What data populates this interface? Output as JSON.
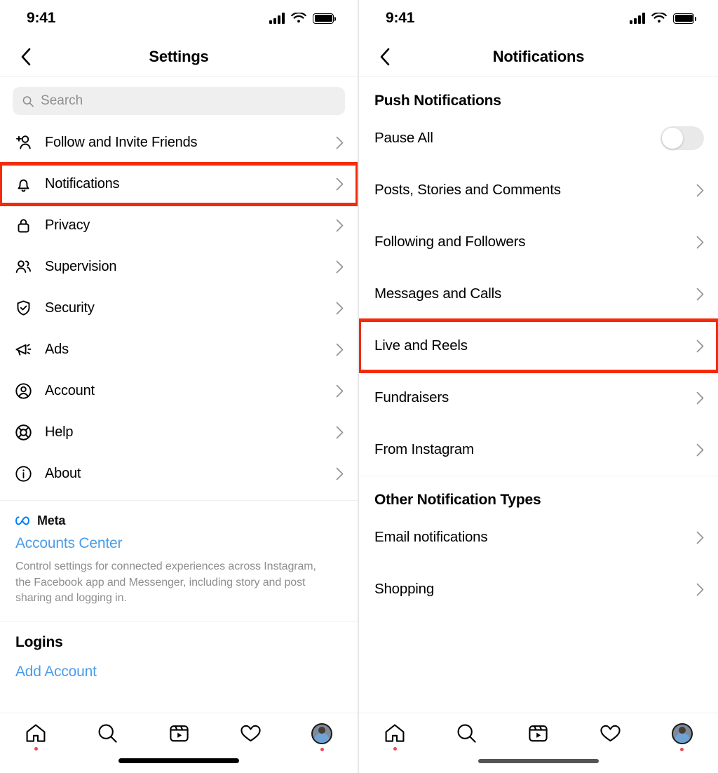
{
  "colors": {
    "highlight_red": "#F22B0A",
    "link_blue": "#4A9DE8",
    "notification_dot": "#ED4956",
    "divider": "#EFEFEF",
    "search_bg": "#EFEFEF",
    "muted_text": "#8E8E8E"
  },
  "left": {
    "status": {
      "time": "9:41",
      "signal_icon": "cellular-signal-icon",
      "wifi_icon": "wifi-icon",
      "battery_icon": "battery-full-icon"
    },
    "nav": {
      "back_icon": "chevron-left-icon",
      "title": "Settings"
    },
    "search": {
      "placeholder": "Search",
      "value": "",
      "icon": "search-icon"
    },
    "menu_items": [
      {
        "label": "Follow and Invite Friends",
        "icon": "add-person-icon",
        "highlighted": false
      },
      {
        "label": "Notifications",
        "icon": "bell-icon",
        "highlighted": true
      },
      {
        "label": "Privacy",
        "icon": "lock-icon",
        "highlighted": false
      },
      {
        "label": "Supervision",
        "icon": "people-icon",
        "highlighted": false
      },
      {
        "label": "Security",
        "icon": "shield-check-icon",
        "highlighted": false
      },
      {
        "label": "Ads",
        "icon": "megaphone-icon",
        "highlighted": false
      },
      {
        "label": "Account",
        "icon": "account-circle-icon",
        "highlighted": false
      },
      {
        "label": "Help",
        "icon": "life-ring-icon",
        "highlighted": false
      },
      {
        "label": "About",
        "icon": "info-circle-icon",
        "highlighted": false
      }
    ],
    "meta": {
      "brand": "Meta",
      "brand_icon": "meta-infinity-icon",
      "accounts_center_link": "Accounts Center",
      "description": "Control settings for connected experiences across Instagram, the Facebook app and Messenger, including story and post sharing and logging in."
    },
    "logins": {
      "heading": "Logins",
      "add_account_link": "Add Account"
    }
  },
  "right": {
    "status": {
      "time": "9:41",
      "signal_icon": "cellular-signal-icon",
      "wifi_icon": "wifi-icon",
      "battery_icon": "battery-full-icon"
    },
    "nav": {
      "back_icon": "chevron-left-icon",
      "title": "Notifications"
    },
    "sections": [
      {
        "title": "Push Notifications",
        "items": [
          {
            "label": "Pause All",
            "control": "toggle",
            "toggle_on": false,
            "highlighted": false
          },
          {
            "label": "Posts, Stories and Comments",
            "control": "chevron",
            "highlighted": false
          },
          {
            "label": "Following and Followers",
            "control": "chevron",
            "highlighted": false
          },
          {
            "label": "Messages and Calls",
            "control": "chevron",
            "highlighted": false
          },
          {
            "label": "Live and Reels",
            "control": "chevron",
            "highlighted": true
          },
          {
            "label": "Fundraisers",
            "control": "chevron",
            "highlighted": false
          },
          {
            "label": "From Instagram",
            "control": "chevron",
            "highlighted": false
          }
        ]
      },
      {
        "title": "Other Notification Types",
        "items": [
          {
            "label": "Email notifications",
            "control": "chevron",
            "highlighted": false
          },
          {
            "label": "Shopping",
            "control": "chevron",
            "highlighted": false
          }
        ]
      }
    ]
  },
  "tabbar": {
    "items": [
      {
        "icon": "home-icon",
        "badge_dot": true
      },
      {
        "icon": "search-icon",
        "badge_dot": false
      },
      {
        "icon": "reels-icon",
        "badge_dot": false
      },
      {
        "icon": "heart-icon",
        "badge_dot": false
      },
      {
        "icon": "profile-avatar-icon",
        "badge_dot": true
      }
    ]
  }
}
